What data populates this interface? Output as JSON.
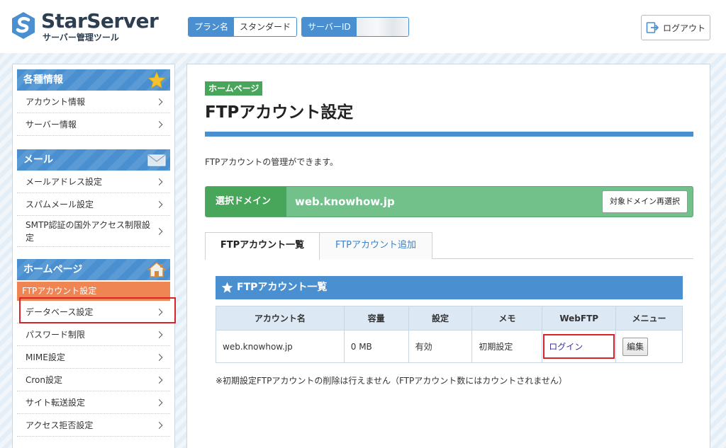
{
  "header": {
    "logo_name": "StarServer",
    "logo_sub": "サーバー管理ツール",
    "plan_label": "プラン名",
    "plan_value": "スタンダード",
    "server_id_label": "サーバーID",
    "server_id_value": "",
    "logout_label": "ログアウト"
  },
  "sidebar": {
    "sections": [
      {
        "title": "各種情報",
        "icon": "star-icon",
        "items": [
          "アカウント情報",
          "サーバー情報"
        ]
      },
      {
        "title": "メール",
        "icon": "mail-icon",
        "items": [
          "メールアドレス設定",
          "スパムメール設定",
          "SMTP認証の国外アクセス制限設定"
        ]
      },
      {
        "title": "ホームページ",
        "icon": "house-icon",
        "items": [
          "FTPアカウント設定",
          "データベース設定",
          "パスワード制限",
          "MIME設定",
          "Cron設定",
          "サイト転送設定",
          "アクセス拒否設定"
        ]
      }
    ],
    "active_item": "FTPアカウント設定"
  },
  "main": {
    "category": "ホームページ",
    "title": "FTPアカウント設定",
    "description": "FTPアカウントの管理ができます。",
    "domain_label": "選択ドメイン",
    "domain_value": "web.knowhow.jp",
    "domain_button": "対象ドメイン再選択",
    "tabs": [
      "FTPアカウント一覧",
      "FTPアカウント追加"
    ],
    "list_title": "FTPアカウント一覧",
    "table": {
      "headers": [
        "アカウント名",
        "容量",
        "設定",
        "メモ",
        "WebFTP",
        "メニュー"
      ],
      "rows": [
        {
          "account": "web.knowhow.jp",
          "capacity": "0 MB",
          "setting": "有効",
          "memo": "初期設定",
          "webftp": "ログイン",
          "menu": "編集"
        }
      ]
    },
    "note": "※初期設定FTPアカウントの削除は行えません（FTPアカウント数にはカウントされません）"
  },
  "colors": {
    "accent_blue": "#4a90d0",
    "green": "#47a65a",
    "domain_green": "#72c08a",
    "active_orange": "#ee8553",
    "highlight_red": "#d8232a"
  }
}
